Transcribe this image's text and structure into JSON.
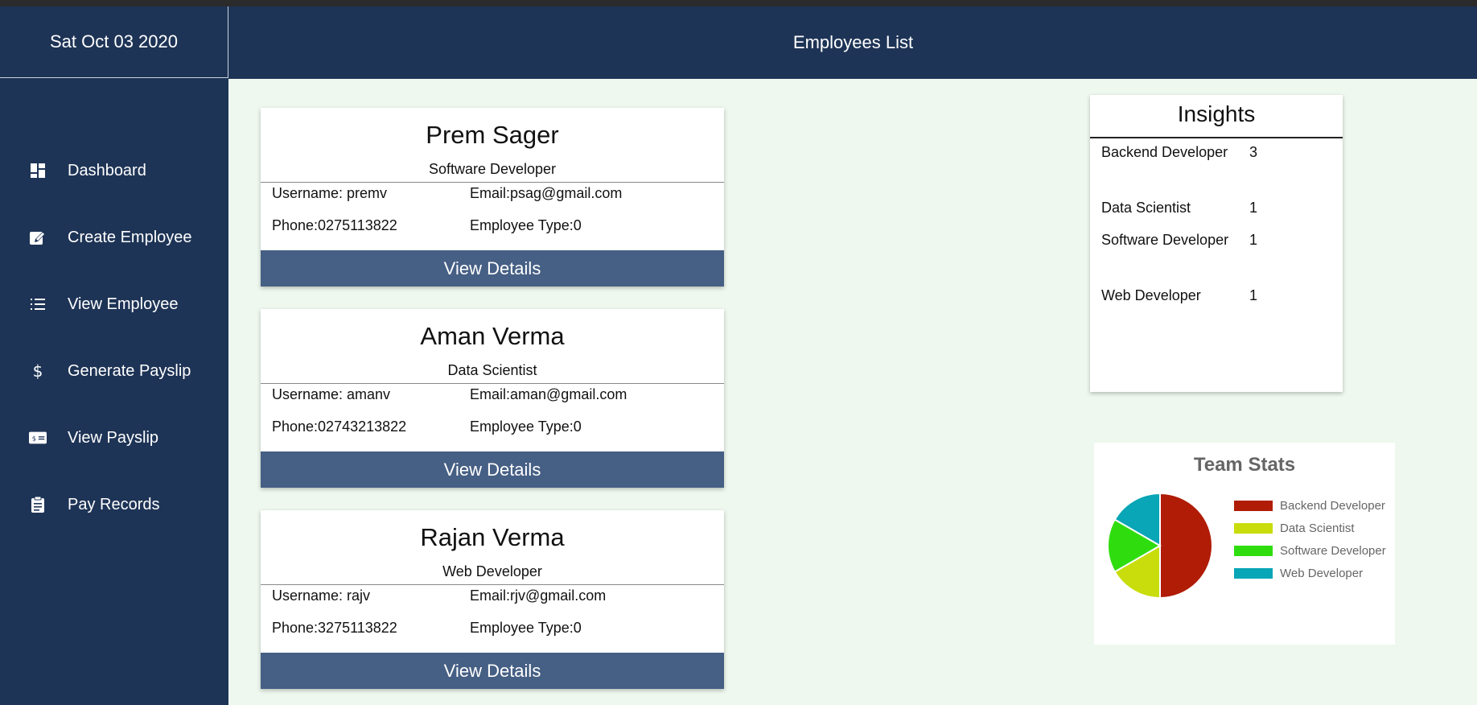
{
  "app": {
    "date": "Sat Oct 03 2020",
    "title": "Employees List"
  },
  "sidebar": {
    "items": [
      {
        "label": "Dashboard",
        "icon": "dashboard-icon"
      },
      {
        "label": "Create Employee",
        "icon": "edit-icon"
      },
      {
        "label": "View Employee",
        "icon": "list-icon"
      },
      {
        "label": "Generate Payslip",
        "icon": "dollar-icon"
      },
      {
        "label": "View Payslip",
        "icon": "payslip-card-icon"
      },
      {
        "label": "Pay Records",
        "icon": "clipboard-icon"
      }
    ]
  },
  "employees": [
    {
      "name": "Prem Sager",
      "role": "Software Developer",
      "username": "Username: premv",
      "email": "Email:psag@gmail.com",
      "phone": "Phone:0275113822",
      "type": "Employee Type:0",
      "button": "View Details"
    },
    {
      "name": "Aman Verma",
      "role": "Data Scientist",
      "username": "Username: amanv",
      "email": "Email:aman@gmail.com",
      "phone": "Phone:02743213822",
      "type": "Employee Type:0",
      "button": "View Details"
    },
    {
      "name": "Rajan Verma",
      "role": "Web Developer",
      "username": "Username: rajv",
      "email": "Email:rjv@gmail.com",
      "phone": "Phone:3275113822",
      "type": "Employee Type:0",
      "button": "View Details"
    }
  ],
  "insights": {
    "title": "Insights",
    "rows": [
      {
        "label": "Backend Developer",
        "value": "3"
      },
      {
        "label": "Data Scientist",
        "value": "1"
      },
      {
        "label": "Software Developer",
        "value": "1"
      },
      {
        "label": "Web Developer",
        "value": "1"
      }
    ]
  },
  "colors": {
    "sidebar": "#1e3456",
    "button": "#465f84",
    "main_bg": "#eef8ee"
  },
  "chart_data": {
    "type": "pie",
    "title": "Team Stats",
    "legend_position": "right",
    "categories": [
      "Backend Developer",
      "Data Scientist",
      "Software Developer",
      "Web Developer"
    ],
    "values": [
      3,
      1,
      1,
      1
    ],
    "colors": [
      "#b01c06",
      "#c8dd0b",
      "#2fdd0f",
      "#08a6b6"
    ]
  }
}
